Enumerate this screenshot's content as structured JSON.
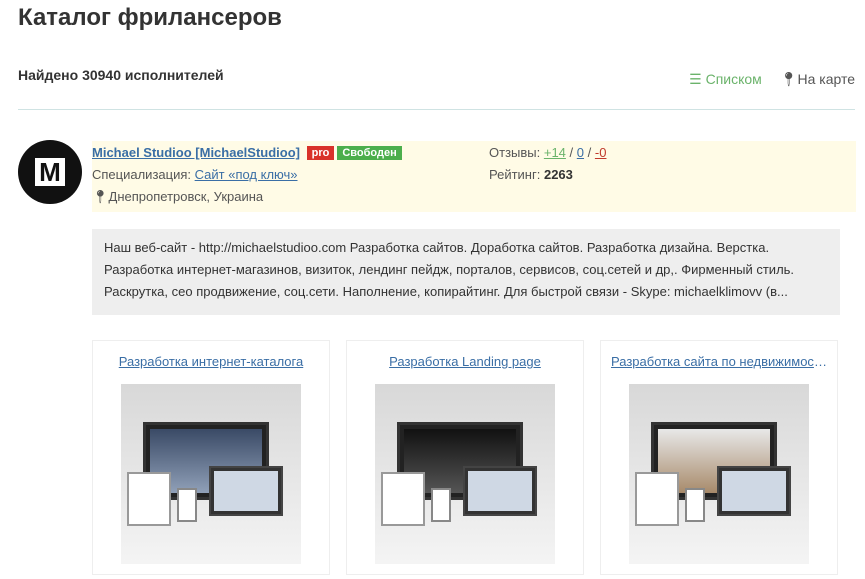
{
  "page": {
    "title": "Каталог фрилансеров",
    "found": "Найдено 30940 исполнителей",
    "view_list": "Списком",
    "view_map": "На карте"
  },
  "freelancer": {
    "name": "Michael Studioo [MichaelStudioo]",
    "pro": "pro",
    "status": "Свободен",
    "spec_label": "Специализация:",
    "spec": "Сайт «под ключ»",
    "location": "Днепропетровск, Украина",
    "reviews_label": "Отзывы:",
    "rev_pos": "+14",
    "rev_neutral": "0",
    "rev_neg": "-0",
    "sep": "/",
    "rating_label": "Рейтинг:",
    "rating": "2263",
    "logo_text": "M",
    "description": "Наш веб-сайт - http://michaelstudioo.com Разработка сайтов. Доработка сайтов. Разработка дизайна. Верстка. Разработка интернет-магазинов, визиток, лендинг пейдж, порталов, сервисов, соц.сетей и др,. Фирменный стиль. Раскрутка, сео продвижение, соц.сети. Наполнение, копирайтинг. Для быстрой связи - Skype: michaelklimovv (в..."
  },
  "portfolio": [
    {
      "title": "Разработка интернет-каталога"
    },
    {
      "title": "Разработка Landing page"
    },
    {
      "title": "Разработка сайта по недвижимост..."
    }
  ],
  "colors": {
    "accent": "#6bb36b",
    "link": "#3a6ea5",
    "pro": "#d9322a",
    "free": "#4cae4c",
    "highlight": "#fffbe6"
  }
}
